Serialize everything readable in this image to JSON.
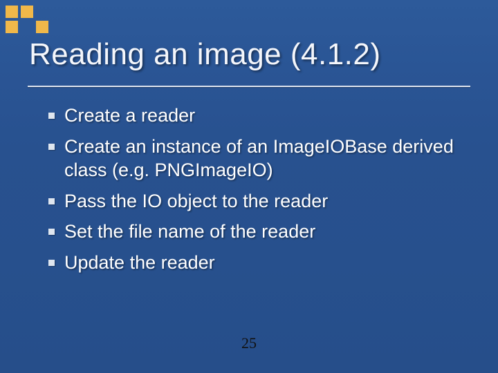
{
  "title": "Reading an image (4.1.2)",
  "bullets": [
    "Create a reader",
    "Create an instance of an ImageIOBase derived class (e.g. PNGImageIO)",
    "Pass the IO object to the reader",
    "Set the file name of the reader",
    "Update the reader"
  ],
  "page_number": "25"
}
